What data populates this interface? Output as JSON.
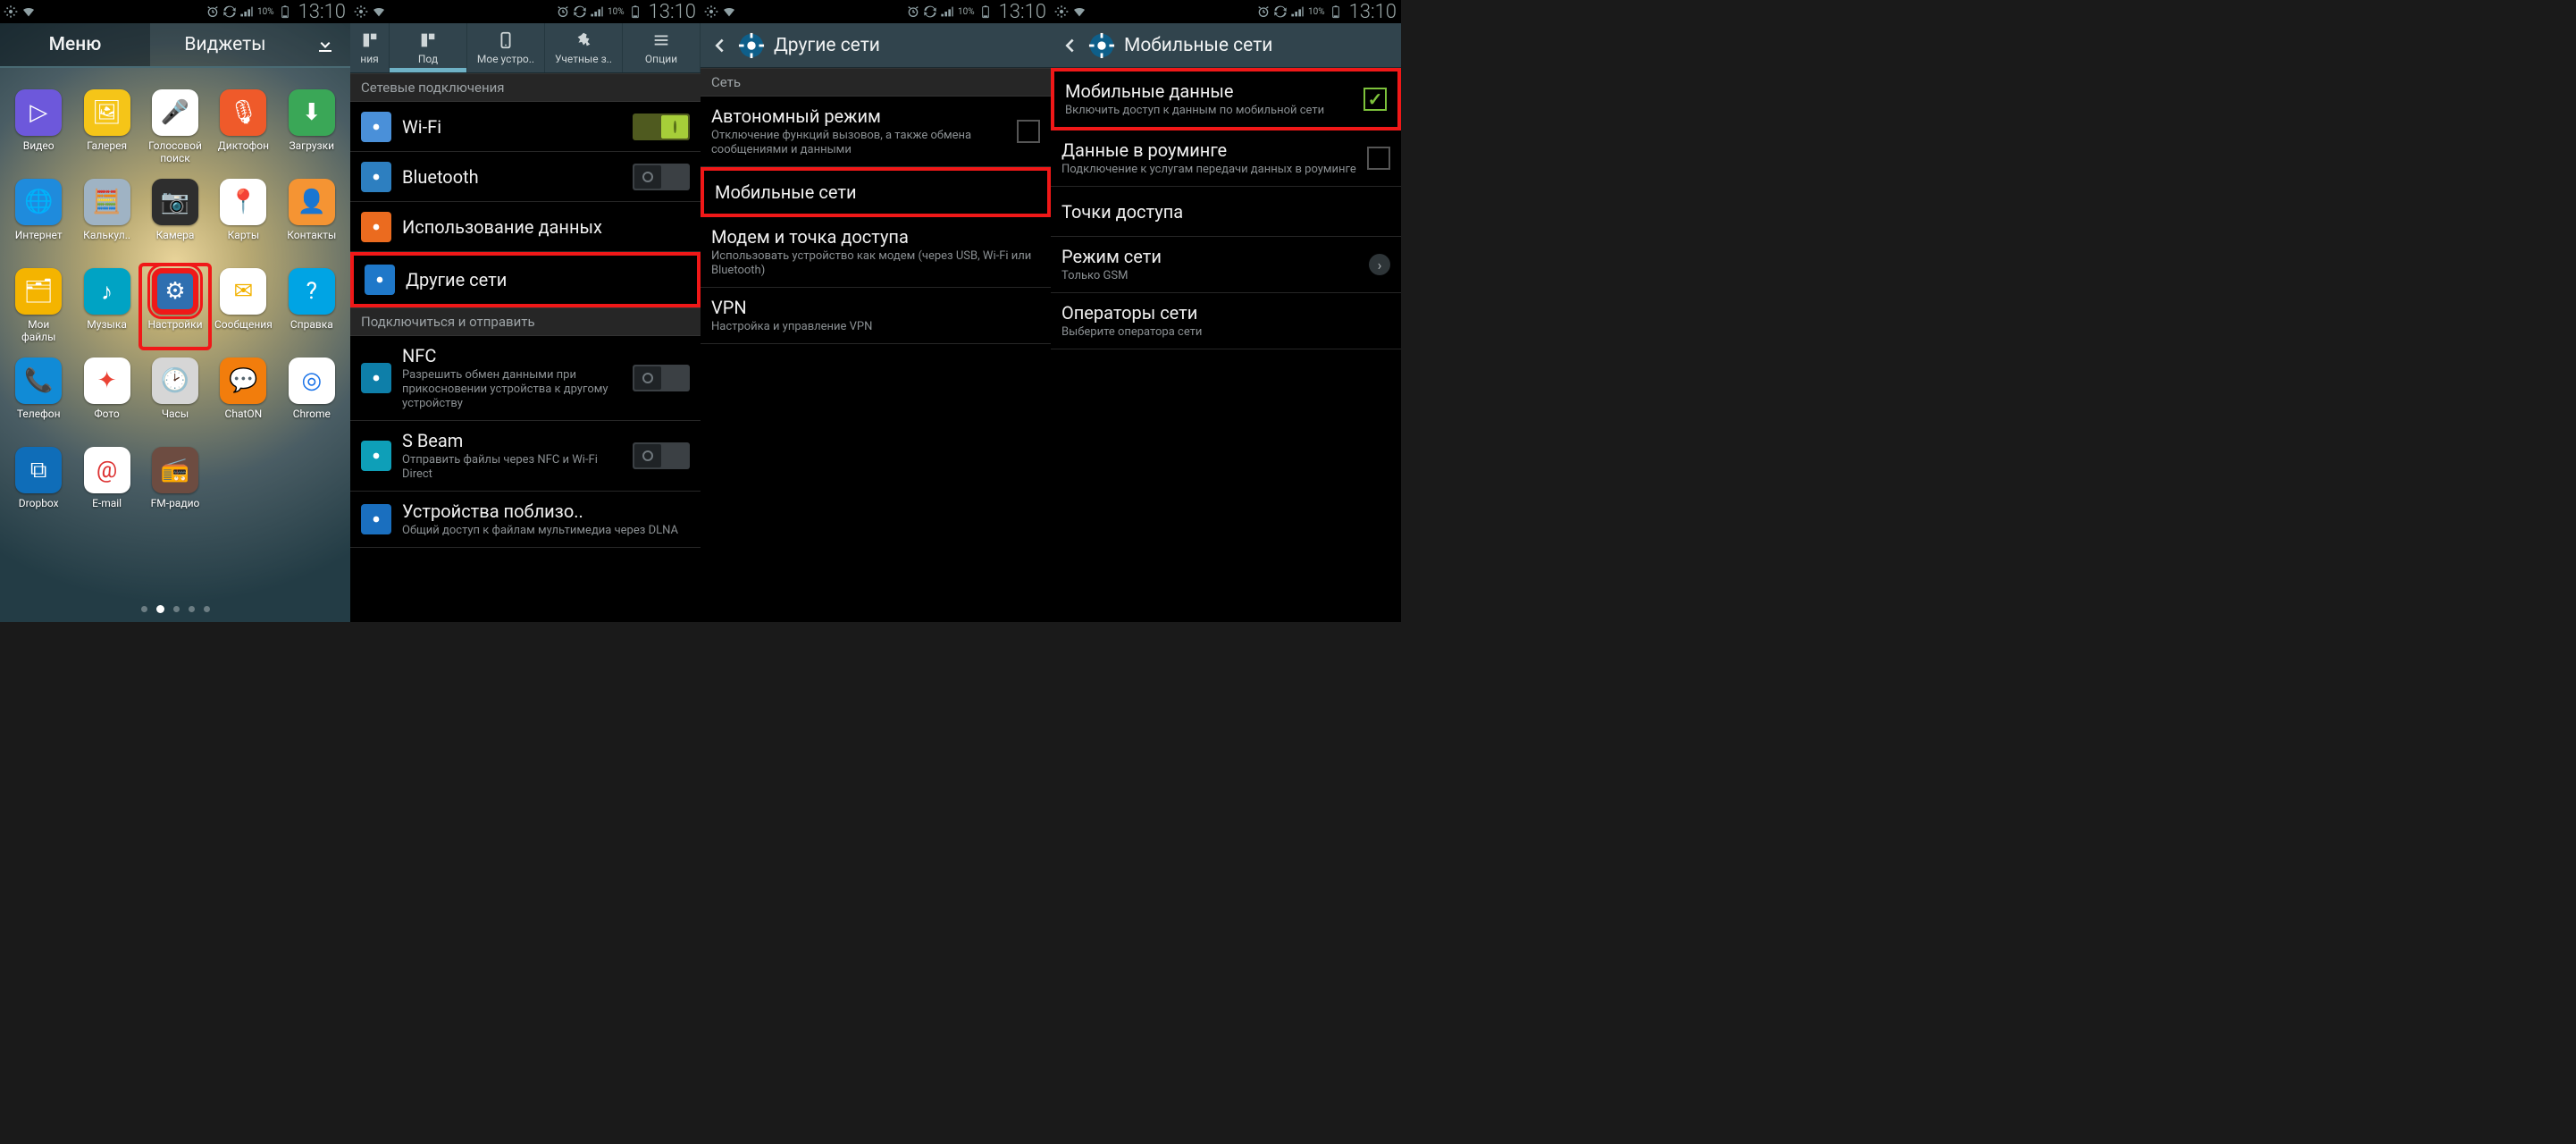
{
  "status": {
    "battery": "10%",
    "time": "13:10"
  },
  "screen1": {
    "tabs": {
      "menu": "Меню",
      "widgets": "Виджеты"
    },
    "apps": [
      {
        "label": "Видео",
        "bg": "#6d58db",
        "glyph": "▷"
      },
      {
        "label": "Галерея",
        "bg": "#f5c518",
        "glyph": "🖼"
      },
      {
        "label": "Голосовой поиск",
        "bg": "#ffffff",
        "glyph": "🎤",
        "fg": "#d33"
      },
      {
        "label": "Диктофон",
        "bg": "#ef5a2a",
        "glyph": "🎙"
      },
      {
        "label": "Загрузки",
        "bg": "#3aa757",
        "glyph": "⬇"
      },
      {
        "label": "Интернет",
        "bg": "#1f8bdc",
        "glyph": "🌐"
      },
      {
        "label": "Калькул..",
        "bg": "#9fb3c4",
        "glyph": "🧮"
      },
      {
        "label": "Камера",
        "bg": "#2e2e2e",
        "glyph": "📷"
      },
      {
        "label": "Карты",
        "bg": "#ffffff",
        "glyph": "📍",
        "fg": "#db4437"
      },
      {
        "label": "Контакты",
        "bg": "#f59433",
        "glyph": "👤"
      },
      {
        "label": "Мои файлы",
        "bg": "#f4b400",
        "glyph": "🗂"
      },
      {
        "label": "Музыка",
        "bg": "#00a3c4",
        "glyph": "♪"
      },
      {
        "label": "Настройки",
        "bg": "#2f6fb0",
        "glyph": "⚙",
        "highlight": true
      },
      {
        "label": "Сообщения",
        "bg": "#ffffff",
        "glyph": "✉",
        "fg": "#f2b200"
      },
      {
        "label": "Справка",
        "bg": "#00a4e4",
        "glyph": "?"
      },
      {
        "label": "Телефон",
        "bg": "#118bd6",
        "glyph": "📞"
      },
      {
        "label": "Фото",
        "bg": "#ffffff",
        "glyph": "✦",
        "fg": "#ea4335"
      },
      {
        "label": "Часы",
        "bg": "#d6d6d6",
        "glyph": "🕑",
        "fg": "#333"
      },
      {
        "label": "ChatON",
        "bg": "#f27d0c",
        "glyph": "💬"
      },
      {
        "label": "Chrome",
        "bg": "#ffffff",
        "glyph": "◎",
        "fg": "#1a73e8"
      },
      {
        "label": "Dropbox",
        "bg": "#0f6db8",
        "glyph": "⧉"
      },
      {
        "label": "E-mail",
        "bg": "#ffffff",
        "glyph": "@",
        "fg": "#d33"
      },
      {
        "label": "FM-радио",
        "bg": "#6d4c41",
        "glyph": "📻"
      }
    ]
  },
  "screen2": {
    "tabs": [
      {
        "label": "ния",
        "active": false
      },
      {
        "label": "Под",
        "active": true
      },
      {
        "label": "Мое устро..",
        "active": false
      },
      {
        "label": "Учетные з..",
        "active": false
      },
      {
        "label": "Опции",
        "active": false
      }
    ],
    "section1": "Сетевые подключения",
    "rows1": [
      {
        "title": "Wi-Fi",
        "icon_bg": "#4a90d9",
        "toggle": "on"
      },
      {
        "title": "Bluetooth",
        "icon_bg": "#2d7fc0",
        "toggle": "off"
      },
      {
        "title": "Использование данных",
        "icon_bg": "#eb6b1f"
      },
      {
        "title": "Другие сети",
        "icon_bg": "#1f78c9",
        "highlight": true
      }
    ],
    "section2": "Подключиться и отправить",
    "rows2": [
      {
        "title": "NFC",
        "sub": "Разрешить обмен данными при прикосновении устройства к другому устройству",
        "icon_bg": "#0e7fa9",
        "toggle": "off"
      },
      {
        "title": "S Beam",
        "sub": "Отправить файлы через NFC и Wi-Fi Direct",
        "icon_bg": "#0e9fb8",
        "toggle": "off"
      },
      {
        "title": "Устройства поблизо..",
        "sub": "Общий доступ к файлам мультимедиа через DLNA",
        "icon_bg": "#1a6fbf"
      }
    ]
  },
  "screen3": {
    "title": "Другие сети",
    "section": "Сеть",
    "rows": [
      {
        "title": "Автономный режим",
        "sub": "Отключение функций вызовов, а также обмена сообщениями и данными",
        "checkbox": false
      },
      {
        "title": "Мобильные сети",
        "highlight": true
      },
      {
        "title": "Модем и точка доступа",
        "sub": "Использовать устройство как модем (через USB, Wi-Fi или Bluetooth)"
      },
      {
        "title": "VPN",
        "sub": "Настройка и управление VPN"
      }
    ]
  },
  "screen4": {
    "title": "Мобильные сети",
    "rows": [
      {
        "title": "Мобильные данные",
        "sub": "Включить доступ к данным по мобильной сети",
        "checkbox": true,
        "highlight": true
      },
      {
        "title": "Данные в роуминге",
        "sub": "Подключение к услугам передачи данных в роуминге",
        "checkbox": false
      },
      {
        "title": "Точки доступа"
      },
      {
        "title": "Режим сети",
        "sub": "Только GSM",
        "chevron": true
      },
      {
        "title": "Операторы сети",
        "sub": "Выберите оператора сети"
      }
    ]
  }
}
